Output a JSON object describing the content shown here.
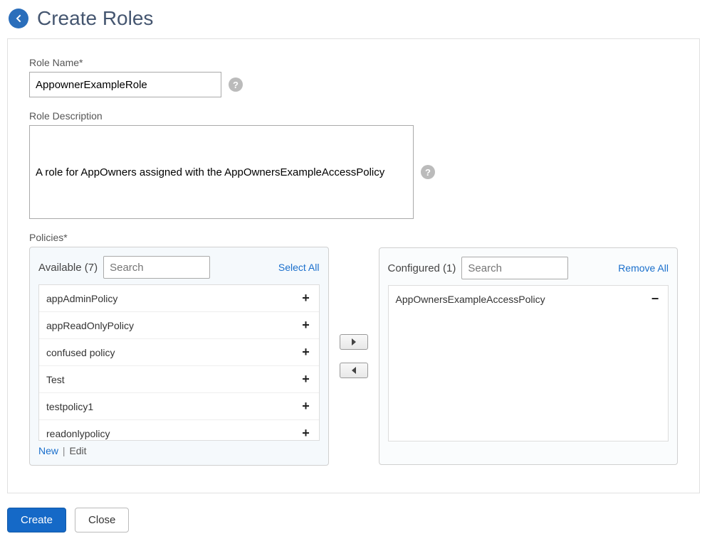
{
  "header": {
    "title": "Create Roles"
  },
  "form": {
    "roleName": {
      "label": "Role Name*",
      "value": "AppownerExampleRole"
    },
    "roleDescription": {
      "label": "Role Description",
      "value": "A role for AppOwners assigned with the AppOwnersExampleAccessPolicy"
    },
    "policiesLabel": "Policies*"
  },
  "available": {
    "title": "Available (7)",
    "searchPlaceholder": "Search",
    "selectAll": "Select All",
    "items": [
      "appAdminPolicy",
      "appReadOnlyPolicy",
      "confused policy",
      "Test",
      "testpolicy1",
      "readonlypolicy"
    ],
    "newLink": "New",
    "editLink": "Edit"
  },
  "configured": {
    "title": "Configured (1)",
    "searchPlaceholder": "Search",
    "removeAll": "Remove All",
    "items": [
      "AppOwnersExampleAccessPolicy"
    ]
  },
  "buttons": {
    "create": "Create",
    "close": "Close"
  },
  "icons": {
    "plus": "+",
    "minus": "−",
    "sep": " | "
  }
}
